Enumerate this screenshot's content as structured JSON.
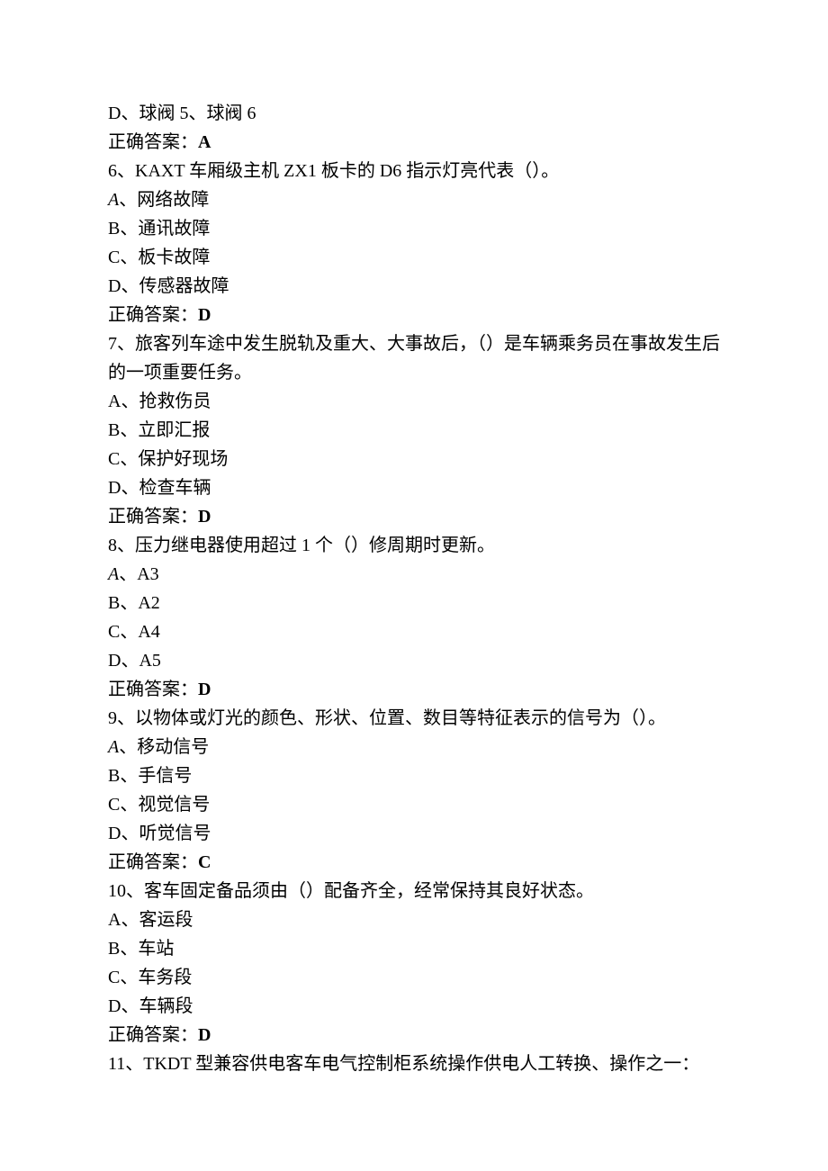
{
  "lines": [
    {
      "text": "D、球阀 5、球阀 6",
      "type": "plain"
    },
    {
      "label": "正确答案：",
      "value": "A",
      "type": "answer"
    },
    {
      "text": "6、KAXT 车厢级主机 ZX1 板卡的 D6 指示灯亮代表（）。",
      "type": "plain"
    },
    {
      "italic": "A",
      "text": "、网络故障",
      "type": "italicA"
    },
    {
      "text": "B、通讯故障",
      "type": "plain"
    },
    {
      "text": "C、板卡故障",
      "type": "plain"
    },
    {
      "text": "D、传感器故障",
      "type": "plain"
    },
    {
      "label": "正确答案：",
      "value": "D",
      "type": "answer"
    },
    {
      "text": "7、旅客列车途中发生脱轨及重大、大事故后，（）是车辆乘务员在事故发生后的一项重要任务。",
      "type": "plain"
    },
    {
      "text": "A、抢救伤员",
      "type": "plain"
    },
    {
      "text": "B、立即汇报",
      "type": "plain"
    },
    {
      "text": "C、保护好现场",
      "type": "plain"
    },
    {
      "text": "D、检查车辆",
      "type": "plain"
    },
    {
      "label": "正确答案：",
      "value": "D",
      "type": "answer"
    },
    {
      "text": "8、压力继电器使用超过 1 个（）修周期时更新。",
      "type": "plain"
    },
    {
      "italic": "A",
      "text": "、A3",
      "type": "italicA"
    },
    {
      "text": "B、A2",
      "type": "plain"
    },
    {
      "text": "C、A4",
      "type": "plain"
    },
    {
      "text": "D、A5",
      "type": "plain"
    },
    {
      "label": "正确答案：",
      "value": "D",
      "type": "answer"
    },
    {
      "text": "9、以物体或灯光的颜色、形状、位置、数目等特征表示的信号为（）。",
      "type": "plain"
    },
    {
      "italic": "A",
      "text": "、移动信号",
      "type": "italicA"
    },
    {
      "text": "B、手信号",
      "type": "plain"
    },
    {
      "text": "C、视觉信号",
      "type": "plain"
    },
    {
      "text": "D、听觉信号",
      "type": "plain"
    },
    {
      "label": "正确答案：",
      "value": "C",
      "type": "answer"
    },
    {
      "text": "10、客车固定备品须由（）配备齐全，经常保持其良好状态。",
      "type": "plain"
    },
    {
      "text": "A、客运段",
      "type": "plain"
    },
    {
      "text": "B、车站",
      "type": "plain"
    },
    {
      "text": "C、车务段",
      "type": "plain"
    },
    {
      "text": "D、车辆段",
      "type": "plain"
    },
    {
      "label": "正确答案：",
      "value": "D",
      "type": "answer"
    },
    {
      "text": "11、TKDT 型兼容供电客车电气控制柜系统操作供电人工转换、操作之一：",
      "type": "plain"
    }
  ]
}
